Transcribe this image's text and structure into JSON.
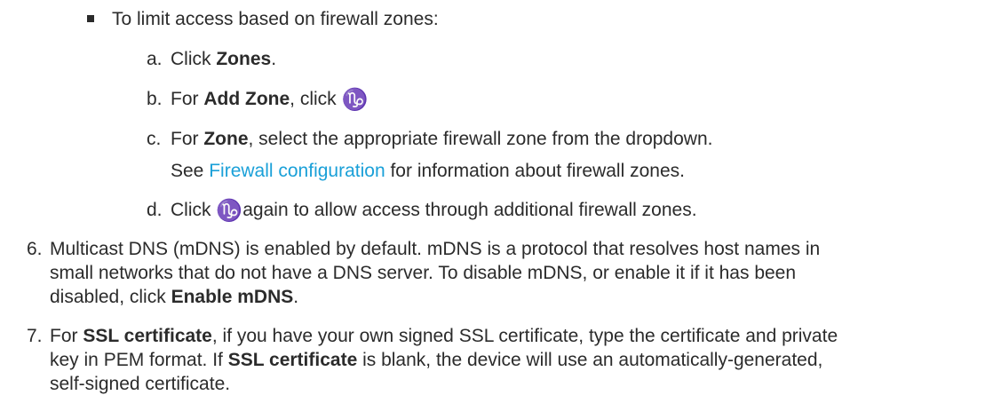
{
  "zones_section": {
    "intro": "To limit access based on firewall zones:",
    "steps": [
      {
        "marker": "a.",
        "pre": "Click ",
        "bold": "Zones",
        "post": "."
      },
      {
        "marker": "b.",
        "pre": "For ",
        "bold": "Add Zone",
        "post": ", click "
      },
      {
        "marker": "c.",
        "pre": "For ",
        "bold": "Zone",
        "post": ", select the appropriate firewall zone from the dropdown."
      },
      {
        "marker": "d.",
        "pre": "Click ",
        "post": "again to allow access through additional firewall zones."
      }
    ],
    "see_pre": "See ",
    "see_link": "Firewall configuration",
    "see_post": " for information about firewall zones.",
    "add_icon_glyph": "♑"
  },
  "step6": {
    "marker": "6.",
    "line1": "Multicast DNS (mDNS) is enabled by default. mDNS is a protocol that resolves host names in",
    "line2": "small networks that do not have a DNS server. To disable mDNS, or enable it if it has been",
    "line3_pre": "disabled, click ",
    "line3_bold": "Enable mDNS",
    "line3_post": "."
  },
  "step7": {
    "marker": "7.",
    "line1_pre": "For ",
    "line1_bold": "SSL certificate",
    "line1_post": ", if you have your own signed SSL certificate, type the certificate and private",
    "line2_pre": "key in PEM format. If ",
    "line2_bold": "SSL certificate",
    "line2_post": " is blank, the device will use an automatically-generated,",
    "line3": "self-signed certificate."
  },
  "colors": {
    "text": "#2b2b2b",
    "link": "#1aa0d8"
  }
}
